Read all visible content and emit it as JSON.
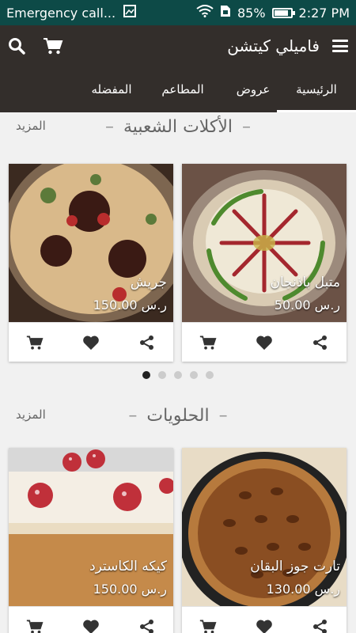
{
  "status_bar": {
    "notification": "Emergency call...",
    "battery": "85%",
    "battery_level": 0.85,
    "time": "2:27 PM"
  },
  "app_bar": {
    "title": "فاميلي كيتشن"
  },
  "tabs": [
    {
      "label": "الرئيسية",
      "active": true
    },
    {
      "label": "عروض",
      "active": false
    },
    {
      "label": "المطاعم",
      "active": false
    },
    {
      "label": "المفضله",
      "active": false
    }
  ],
  "sections": [
    {
      "title": "الأكلات الشعبية",
      "more": "المزيد",
      "items": [
        {
          "name": "متبل باذنجان",
          "price": "50.00 ر.س"
        },
        {
          "name": "جريش",
          "price": "150.00 ر.س"
        }
      ]
    },
    {
      "title": "الحلويات",
      "more": "المزيد",
      "items": [
        {
          "name": "تارت جوز البقان",
          "price": "130.00 ر.س"
        },
        {
          "name": "كيكه الكاسترد",
          "price": "150.00 ر.س"
        }
      ]
    }
  ],
  "carousel": {
    "pages": 5,
    "active_index": 0
  },
  "colors": {
    "status_bar": "#0d4a47",
    "app_bar": "#332e2b",
    "background": "#f1f1f1"
  }
}
